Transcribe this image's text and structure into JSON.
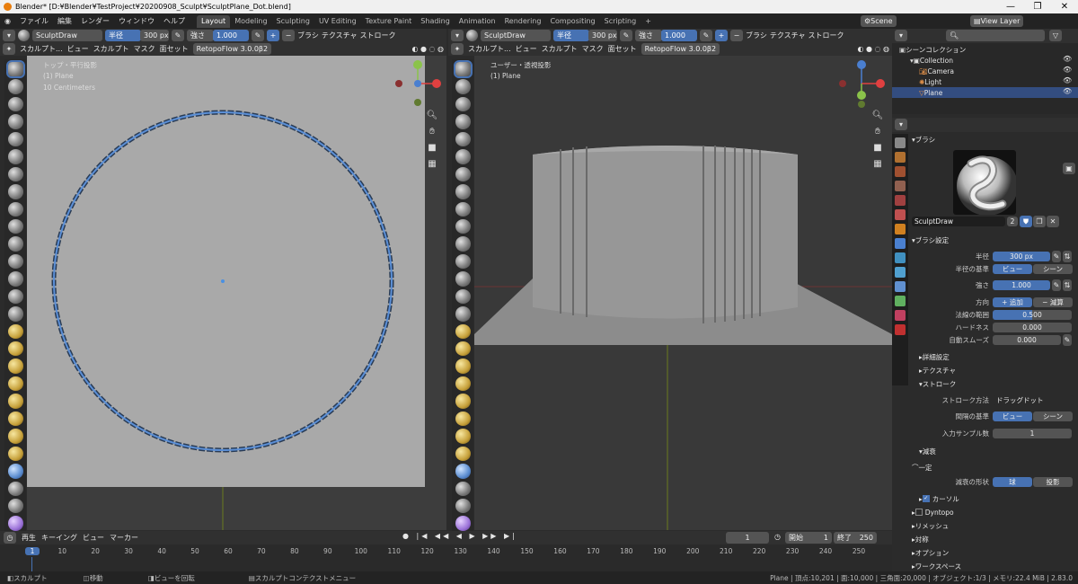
{
  "window": {
    "title": "Blender* [D:¥Blender¥TestProject¥20200908_Sculpt¥SculptPlane_Dot.blend]",
    "min": "—",
    "max": "❐",
    "close": "✕"
  },
  "menu": [
    "ファイル",
    "編集",
    "レンダー",
    "ウィンドウ",
    "ヘルプ"
  ],
  "workspaces": [
    {
      "label": "Layout",
      "active": true
    },
    {
      "label": "Modeling"
    },
    {
      "label": "Sculpting"
    },
    {
      "label": "UV Editing"
    },
    {
      "label": "Texture Paint"
    },
    {
      "label": "Shading"
    },
    {
      "label": "Animation"
    },
    {
      "label": "Rendering"
    },
    {
      "label": "Compositing"
    },
    {
      "label": "Scripting"
    },
    {
      "label": "+"
    }
  ],
  "scene": "Scene",
  "view_layer": "View Layer",
  "tool_header": {
    "brush": "SculptDraw",
    "radius_label": "半径",
    "radius": "300 px",
    "strength_label": "強さ",
    "strength": "1.000",
    "brush_menu": "ブラシ",
    "texture_menu": "テクスチャ",
    "stroke_menu": "ストローク"
  },
  "right_tool_header": {
    "brush": "SculptDraw",
    "radius_label": "半径",
    "radius": "300 px",
    "strength_label": "強さ",
    "strength": "1.000",
    "brush_menu": "ブラシ",
    "texture_menu": "テクスチャ",
    "stroke_menu": "ストローク"
  },
  "vp_header": {
    "mode": "スカルプト...",
    "view": "ビュー",
    "sculpt": "スカルプト",
    "mask": "マスク",
    "faceset": "面セット",
    "addon": "RetopoFlow 3.0.0β2"
  },
  "left_vp": {
    "view_name": "トップ・平行投影",
    "object": "(1) Plane",
    "scale": "10 Centimeters"
  },
  "right_vp": {
    "view_name": "ユーザー・透視投影",
    "object": "(1) Plane"
  },
  "outliner": {
    "root": "シーンコレクション",
    "items": [
      {
        "label": "Collection"
      },
      {
        "label": "Camera"
      },
      {
        "label": "Light"
      },
      {
        "label": "Plane",
        "selected": true
      }
    ]
  },
  "props": {
    "brush_panel": "ブラシ",
    "brush_name": "SculptDraw",
    "brush_users": "2",
    "brush_settings": "ブラシ設定",
    "radius_label": "半径",
    "radius": "300 px",
    "radius_base_label": "半径の基準",
    "view": "ビュー",
    "scene": "シーン",
    "strength_label": "強さ",
    "strength": "1.000",
    "direction_label": "方向",
    "add": "追加",
    "subtract": "減算",
    "normal_radius_label": "法線の範囲",
    "normal_radius": "0.500",
    "hardness_label": "ハードネス",
    "hardness": "0.000",
    "autosmooth_label": "自動スムーズ",
    "autosmooth": "0.000",
    "advanced": "詳細設定",
    "texture": "テクスチャ",
    "stroke": "ストローク",
    "stroke_method_label": "ストローク方法",
    "stroke_method": "ドラッグドット",
    "spacing_label": "間隔の基準",
    "spacing_view": "ビュー",
    "spacing_scene": "シーン",
    "input_samples_label": "入力サンプル数",
    "input_samples": "1",
    "falloff": "減衰",
    "falloff_preset": "一定",
    "falloff_shape_label": "減衰の形状",
    "sphere": "球",
    "projected": "投影",
    "cursor": "カーソル",
    "dyntopo": "Dyntopo",
    "remesh": "リメッシュ",
    "symmetry": "対称",
    "options": "オプション",
    "workspace": "ワークスペース"
  },
  "timeline": {
    "playback": "再生",
    "keying": "キーイング",
    "view": "ビュー",
    "marker": "マーカー",
    "current": "1",
    "start_label": "開始",
    "start": "1",
    "end_label": "終了",
    "end": "250",
    "ticks": [
      "1",
      "10",
      "20",
      "30",
      "40",
      "50",
      "60",
      "70",
      "80",
      "90",
      "100",
      "110",
      "120",
      "130",
      "140",
      "150",
      "160",
      "170",
      "180",
      "190",
      "200",
      "210",
      "220",
      "230",
      "240",
      "250"
    ]
  },
  "status": {
    "sculpt": "スカルプト",
    "move": "移動",
    "rotate": "ビューを回転",
    "context": "スカルプトコンテクストメニュー",
    "stats": "Plane | 頂点:10,201 | 面:10,000 | 三角面:20,000 | オブジェクト:1/3 | メモリ:22.4 MiB | 2.83.0"
  }
}
